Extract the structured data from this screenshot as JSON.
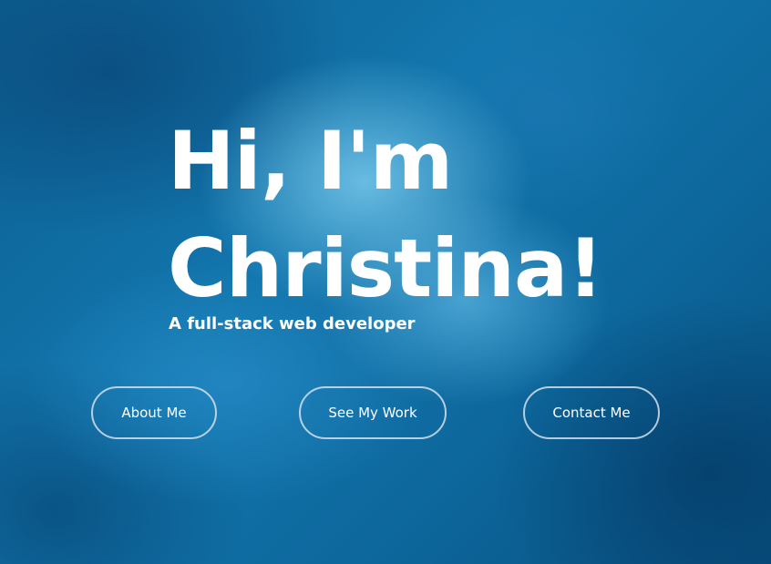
{
  "hero": {
    "headline_line1": "Hi, I'm",
    "headline_line2": "Christina!",
    "subtitle": "A full-stack web developer"
  },
  "buttons": {
    "about": "About Me",
    "work": "See My Work",
    "contact": "Contact Me"
  },
  "colors": {
    "background_primary": "#0a5a8c",
    "text": "#ffffff",
    "button_border": "#d2e1eb"
  }
}
